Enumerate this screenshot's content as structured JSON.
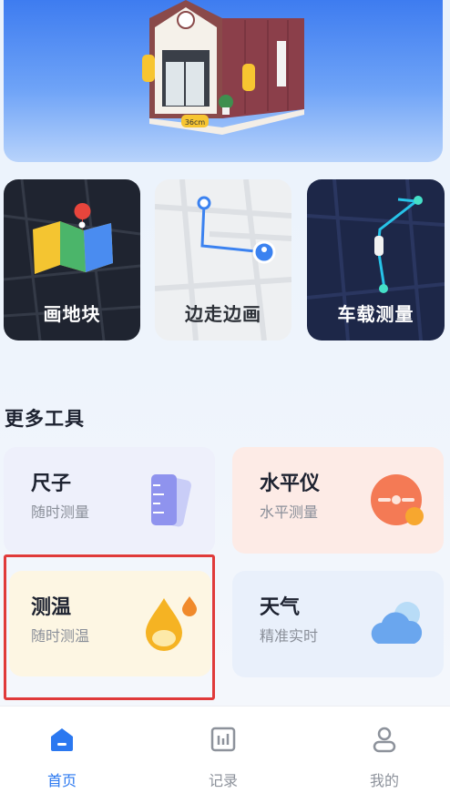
{
  "banner": {
    "dimension_label": "36cm"
  },
  "features": [
    {
      "label": "画地块"
    },
    {
      "label": "边走边画"
    },
    {
      "label": "车载测量"
    }
  ],
  "section": {
    "title": "更多工具"
  },
  "tools": [
    {
      "name": "尺子",
      "desc": "随时测量"
    },
    {
      "name": "水平仪",
      "desc": "水平测量"
    },
    {
      "name": "测温",
      "desc": "随时测温"
    },
    {
      "name": "天气",
      "desc": "精准实时"
    }
  ],
  "nav": {
    "home": "首页",
    "records": "记录",
    "mine": "我的"
  },
  "colors": {
    "accent": "#2b78f0",
    "highlight_border": "#e03a3a"
  }
}
